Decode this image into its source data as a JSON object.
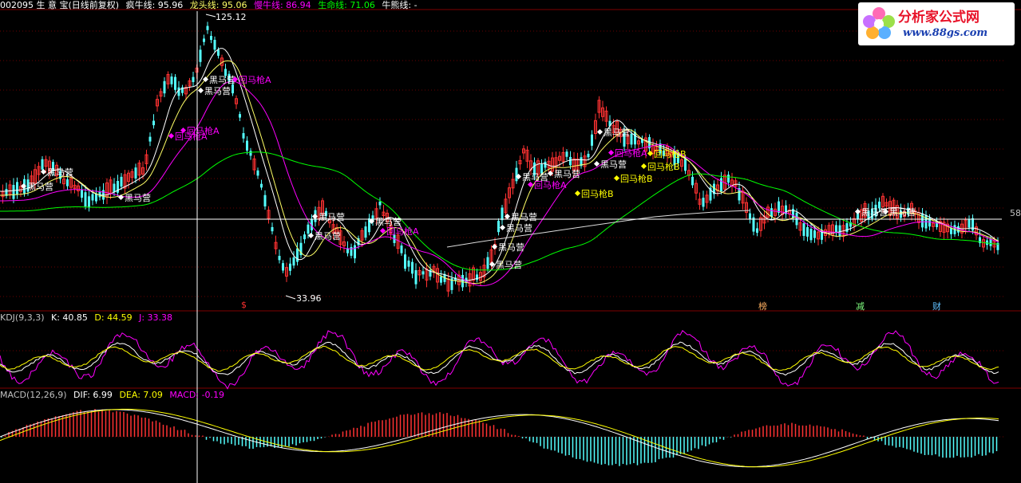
{
  "header": {
    "code_name": "002095 生 意 宝(日线前复权)",
    "items": [
      {
        "label": "疯牛线: 95.96",
        "color": "#ffffff"
      },
      {
        "label": "龙头线: 95.06",
        "color": "#ffff66"
      },
      {
        "label": "慢牛线: 86.94",
        "color": "#ff00ff"
      },
      {
        "label": "生命线: 71.06",
        "color": "#00ff00"
      },
      {
        "label": "牛熊线: -",
        "color": "#ffffff"
      }
    ]
  },
  "kdj_header": {
    "title": "KDJ(9,3,3)",
    "k": "K: 40.85",
    "d": "D: 44.59",
    "j": "J: 33.38"
  },
  "macd_header": {
    "title": "MACD(12,26,9)",
    "dif": "DIF: 6.99",
    "dea": "DEA: 7.09",
    "macd": "MACD: -0.19"
  },
  "logo": {
    "name": "分析家公式网",
    "url": "www.88gs.com"
  },
  "events": [
    "$",
    "榜",
    "减",
    "财"
  ],
  "right_label": "58",
  "chart_data": {
    "type": "line",
    "extremes": {
      "high": "125.12",
      "low": "33.96"
    },
    "signals": [
      "黑马营",
      "回马枪A",
      "回马枪B"
    ],
    "series": [
      {
        "name": "疯牛线",
        "color": "#ffffff"
      },
      {
        "name": "龙头线",
        "color": "#ffff66"
      },
      {
        "name": "慢牛线",
        "color": "#ff00ff"
      },
      {
        "name": "生命线",
        "color": "#00ff00"
      }
    ],
    "grid": false
  },
  "colors": {
    "up": "#ff3232",
    "down": "#54ffff",
    "crosshair": "#ffffff"
  }
}
